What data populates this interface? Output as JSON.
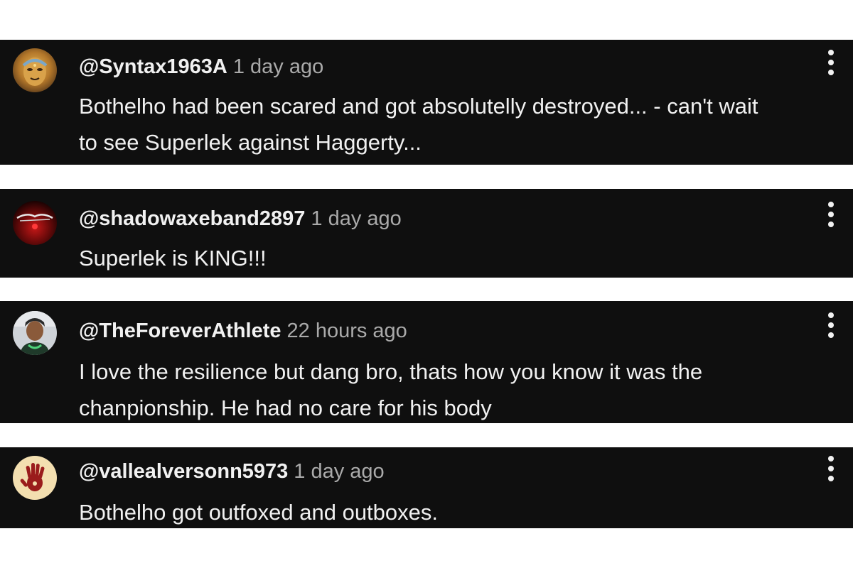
{
  "comments": [
    {
      "handle": "@Syntax1963A",
      "time": "1 day ago",
      "text_line1": "Bothelho had been scared and got absolutelly destroyed... - can't wait",
      "text_line2": "to see Superlek against Haggerty...",
      "avatar_icon": "golden-buddha-face-avatar-icon"
    },
    {
      "handle": "@shadowaxeband2897",
      "time": "1 day ago",
      "text_line1": "Superlek is KING!!!",
      "avatar_icon": "red-band-logo-avatar-icon"
    },
    {
      "handle": "@TheForeverAthlete",
      "time": "22 hours ago",
      "text_line1": "I love the resilience but dang bro, thats how you know it was the",
      "text_line2": "chanpionship. He had no care for his body",
      "avatar_icon": "person-photo-avatar-icon"
    },
    {
      "handle": "@vallealversonn5973",
      "time": "1 day ago",
      "text_line1": "Bothelho got outfoxed and outboxes.",
      "avatar_icon": "red-handprint-avatar-icon"
    }
  ],
  "colors": {
    "card_bg": "#0f0f0f",
    "text_primary": "#f1f1f1",
    "text_secondary": "#aaaaaa",
    "page_bg": "#ffffff"
  },
  "menu_icon": "more-vertical-icon"
}
